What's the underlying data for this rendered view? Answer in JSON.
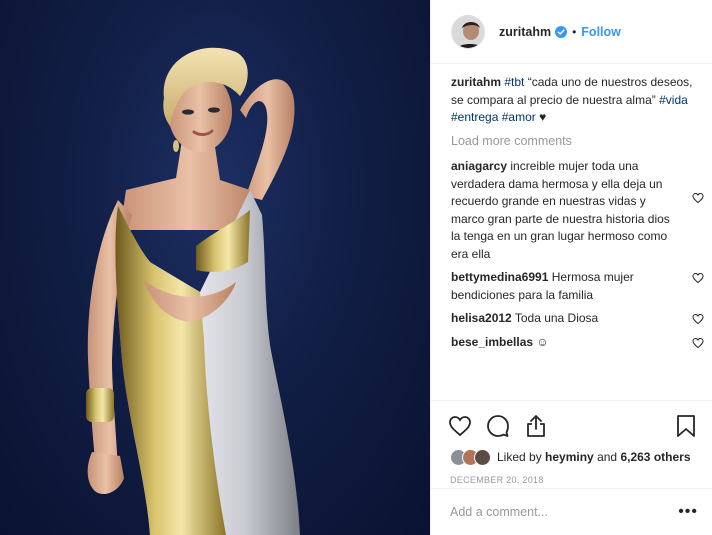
{
  "post": {
    "username": "zuritahm",
    "follow_label": "Follow",
    "separator": "•",
    "caption": {
      "user": "zuritahm",
      "tbt_tag": "#tbt",
      "text": "“cada uno de nuestros deseos, se compara al precio de nuestra alma”",
      "tag_vida": "#vida",
      "tag_entrega": "#entrega",
      "tag_amor": "#amor",
      "emoji": "♥"
    },
    "load_more": "Load more comments",
    "comments": [
      {
        "user": "aniagarcy",
        "text": "increible mujer toda una verdadera dama hermosa y ella deja un recuerdo grande en nuestras vidas y marco gran parte de nuestra historia dios la tenga en un gran lugar hermoso como era ella"
      },
      {
        "user": "bettymedina6991",
        "text": "Hermosa mujer bendiciones para la familia"
      },
      {
        "user": "helisa2012",
        "text": "Toda una Diosa"
      },
      {
        "user": "bese_imbellas",
        "text": "☺"
      }
    ],
    "likes": {
      "prefix": "Liked by",
      "user": "heyminy",
      "and": "and",
      "count": "6,263 others"
    },
    "date": "DECEMBER 20, 2018",
    "add_comment_placeholder": "Add a comment...",
    "more_options": "•••"
  },
  "colors": {
    "link": "#3897f0",
    "hashtag": "#003569",
    "muted": "#999999",
    "verified": "#3897f0"
  },
  "icons": {
    "like": "heart-icon",
    "comment": "comment-bubble-icon",
    "share": "share-icon",
    "save": "bookmark-icon",
    "verified": "verified-badge-icon"
  }
}
